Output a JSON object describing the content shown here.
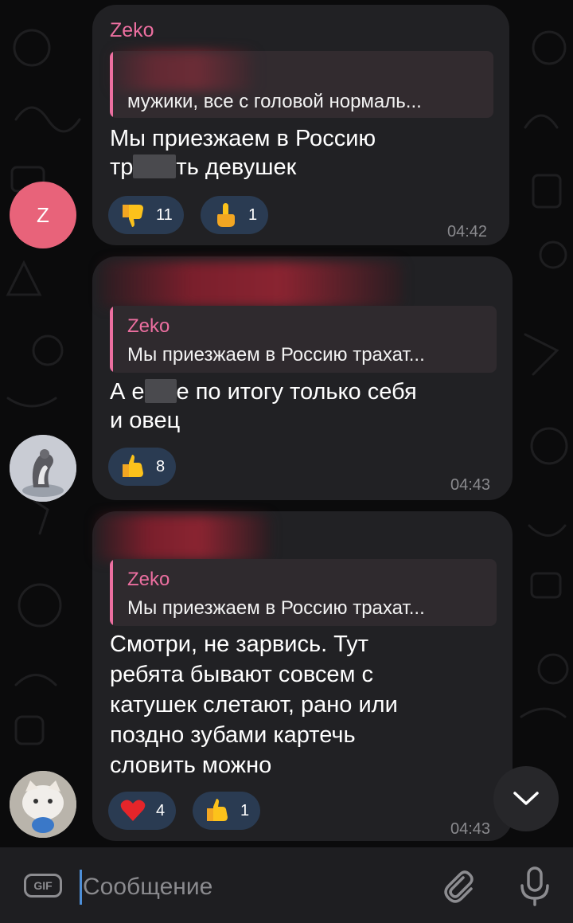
{
  "messages": [
    {
      "sender": "Zeko",
      "reply_text": "мужики, все с головой нормаль...",
      "text_line1": "Мы приезжаем в Россию",
      "text_line2_a": "тр",
      "text_line2_b": "ть девушек",
      "reactions": [
        {
          "emoji": "thumbs-down",
          "count": "11"
        },
        {
          "emoji": "middle-finger",
          "count": "1"
        }
      ],
      "time": "04:42",
      "avatar_letter": "Z"
    },
    {
      "reply_name": "Zeko",
      "reply_text": "Мы приезжаем в Россию трахат...",
      "text_line1_a": "А е",
      "text_line1_b": "е по итогу только себя",
      "text_line2": "и овец",
      "reactions": [
        {
          "emoji": "thumbs-up",
          "count": "8"
        }
      ],
      "time": "04:43"
    },
    {
      "reply_name": "Zeko",
      "reply_text": "Мы приезжаем в Россию трахат...",
      "text_lines": [
        "Смотри, не зарвись. Тут",
        "ребята бывают совсем с",
        "катушек слетают, рано или",
        "поздно зубами картечь",
        "словить можно"
      ],
      "reactions": [
        {
          "emoji": "red-heart",
          "count": "4"
        },
        {
          "emoji": "thumbs-up",
          "count": "1"
        }
      ],
      "time": "04:43"
    }
  ],
  "input": {
    "placeholder": "Сообщение",
    "gif_label": "GIF"
  },
  "colors": {
    "background": "#0b0b0c",
    "bubble": "#212124",
    "sender_name": "#ec6fa0",
    "reaction_pill": "#2a3b52",
    "time": "#8a8a8e",
    "input_bar": "#1e1e21",
    "caret": "#4e8fd8",
    "avatar_z": "#e8637a"
  }
}
